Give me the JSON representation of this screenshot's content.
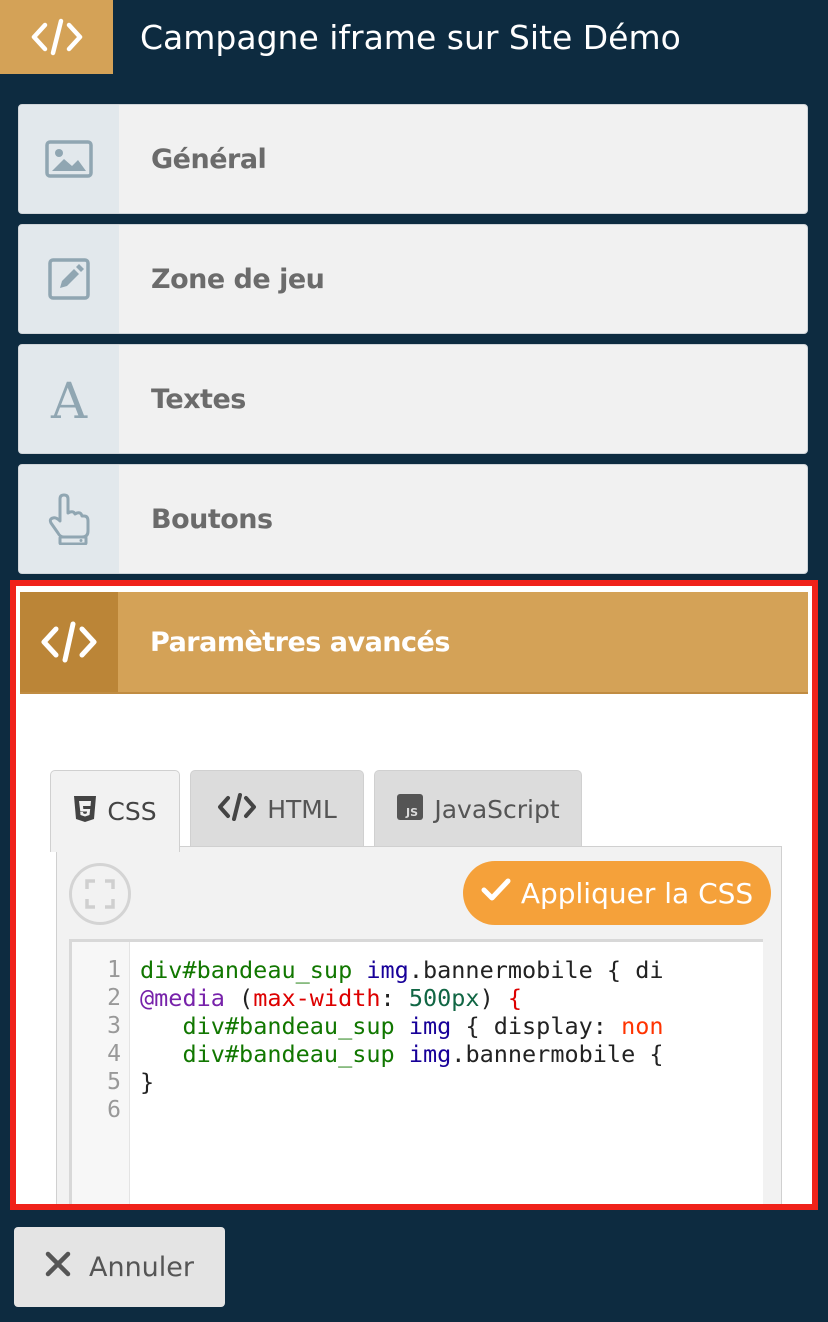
{
  "header": {
    "title": "Campagne iframe sur Site Démo",
    "icon": "code-icon",
    "accent_color": "#d4a257",
    "background_color": "#0d2b40"
  },
  "sections": [
    {
      "label": "Général",
      "icon": "image-icon"
    },
    {
      "label": "Zone de jeu",
      "icon": "edit-icon"
    },
    {
      "label": "Textes",
      "icon": "font-icon"
    },
    {
      "label": "Boutons",
      "icon": "pointer-hand-icon"
    }
  ],
  "advanced": {
    "label": "Paramètres avancés",
    "icon": "code-icon",
    "highlight_color": "#f0221a"
  },
  "tabs": [
    {
      "label": "CSS",
      "icon": "css3-icon",
      "active": true
    },
    {
      "label": "HTML",
      "icon": "code-icon",
      "active": false
    },
    {
      "label": "JavaScript",
      "icon": "js-icon",
      "active": false
    }
  ],
  "editor": {
    "apply_label": "Appliquer la CSS",
    "apply_color": "#f5a13a",
    "line_numbers": [
      "1",
      "2",
      "3",
      "4",
      "5",
      "6"
    ],
    "lines": [
      {
        "tokens": [
          {
            "t": "div#bandeau_sup",
            "c": "tk-sel"
          },
          {
            "t": " ",
            "c": ""
          },
          {
            "t": "img",
            "c": "tk-tag"
          },
          {
            "t": ".bannermobile { di",
            "c": ""
          }
        ]
      },
      {
        "tokens": [
          {
            "t": "@media",
            "c": "tk-kw"
          },
          {
            "t": " (",
            "c": ""
          },
          {
            "t": "max-width",
            "c": "tk-prop"
          },
          {
            "t": ": ",
            "c": ""
          },
          {
            "t": "500px",
            "c": "tk-num"
          },
          {
            "t": ") ",
            "c": ""
          },
          {
            "t": "{",
            "c": "tk-brace"
          }
        ]
      },
      {
        "tokens": [
          {
            "t": "   ",
            "c": ""
          },
          {
            "t": "div#bandeau_sup",
            "c": "tk-sel"
          },
          {
            "t": " ",
            "c": ""
          },
          {
            "t": "img",
            "c": "tk-tag"
          },
          {
            "t": " { display: ",
            "c": ""
          },
          {
            "t": "non",
            "c": "tk-val"
          }
        ]
      },
      {
        "tokens": [
          {
            "t": "   ",
            "c": ""
          },
          {
            "t": "div#bandeau_sup",
            "c": "tk-sel"
          },
          {
            "t": " ",
            "c": ""
          },
          {
            "t": "img",
            "c": "tk-tag"
          },
          {
            "t": ".bannermobile {",
            "c": ""
          }
        ]
      },
      {
        "tokens": [
          {
            "t": "}",
            "c": ""
          }
        ]
      },
      {
        "tokens": []
      }
    ]
  },
  "footer": {
    "cancel_label": "Annuler",
    "cancel_icon": "close-icon"
  }
}
